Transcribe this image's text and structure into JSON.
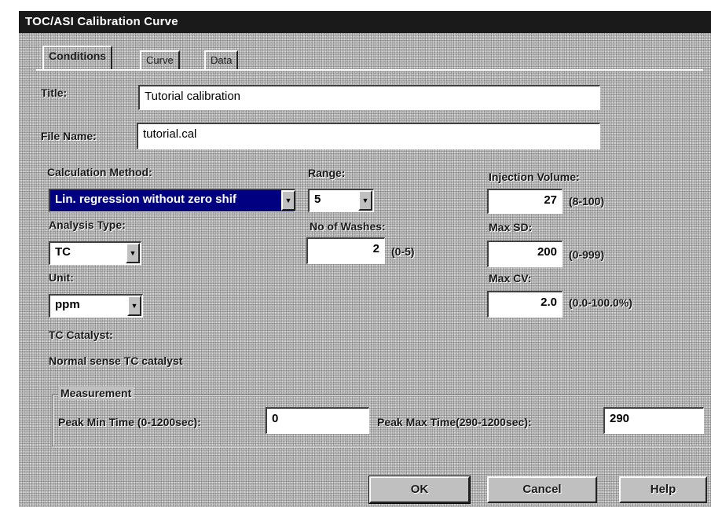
{
  "window": {
    "title": "TOC/ASI Calibration Curve"
  },
  "tabs": [
    {
      "label": "Conditions"
    },
    {
      "label": "Curve"
    },
    {
      "label": "Data"
    }
  ],
  "form": {
    "title_label": "Title:",
    "title_value": "Tutorial calibration",
    "filename_label": "File Name:",
    "filename_value": "tutorial.cal",
    "calc_method_label": "Calculation Method:",
    "calc_method_value": "Lin. regression without zero shif",
    "range_label": "Range:",
    "range_value": "5",
    "injection_volume_label": "Injection Volume:",
    "injection_volume_value": "27",
    "injection_volume_range": "(8-100)",
    "analysis_type_label": "Analysis Type:",
    "analysis_type_value": "TC",
    "washes_label": "No of Washes:",
    "washes_value": "2",
    "washes_range": "(0-5)",
    "max_sd_label": "Max SD:",
    "max_sd_value": "200",
    "max_sd_range": "(0-999)",
    "unit_label": "Unit:",
    "unit_value": "ppm",
    "max_cv_label": "Max CV:",
    "max_cv_value": "2.0",
    "max_cv_range": "(0.0-100.0%)",
    "tc_catalyst_label": "TC Catalyst:",
    "tc_catalyst_value": "Normal sense TC catalyst"
  },
  "measurement": {
    "group_label": "Measurement",
    "peak_min_label": "Peak Min Time (0-1200sec):",
    "peak_min_value": "0",
    "peak_max_label": "Peak Max Time(290-1200sec):",
    "peak_max_value": "290"
  },
  "buttons": {
    "ok": "OK",
    "cancel": "Cancel",
    "help": "Help"
  }
}
